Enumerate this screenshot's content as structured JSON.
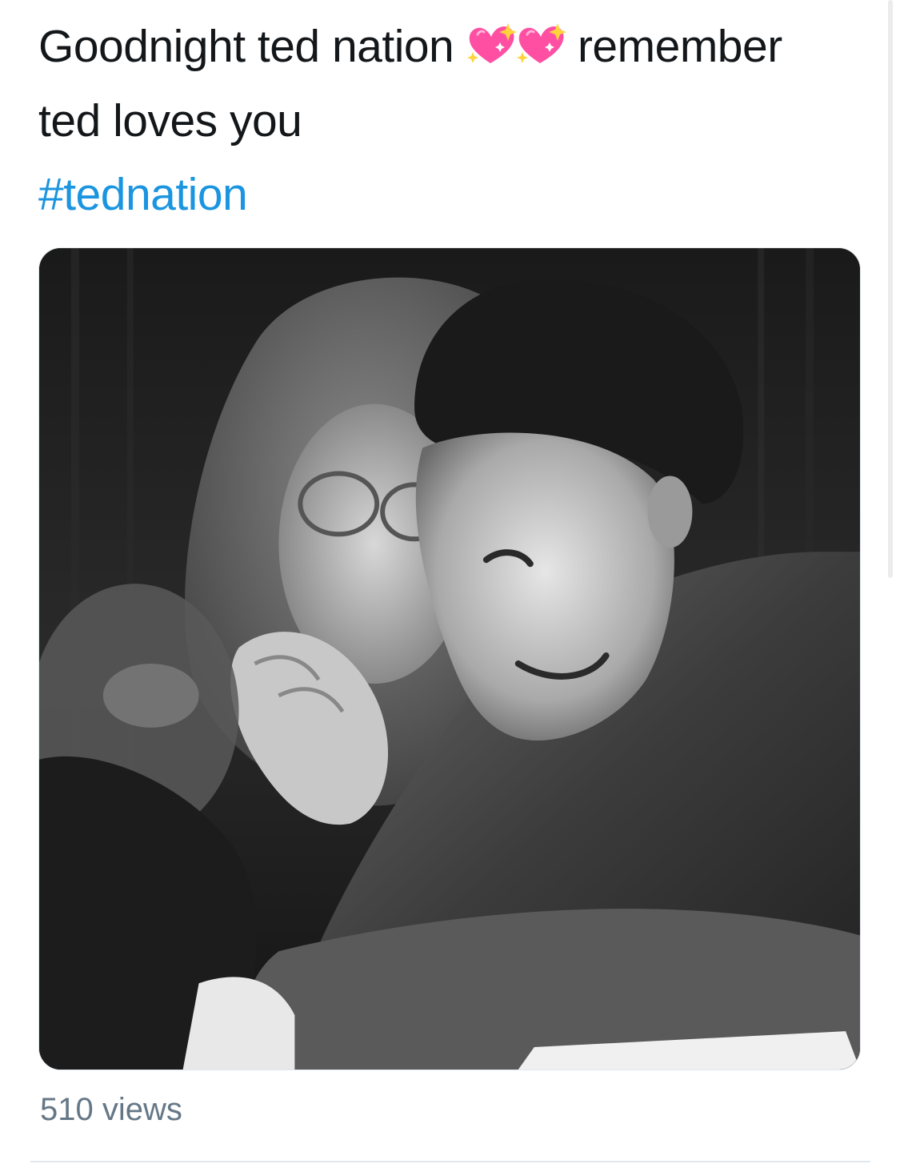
{
  "tweet": {
    "text_line1_a": "Goodnight ted nation",
    "text_line1_b": "remember",
    "text_line2": "ted loves you",
    "emojis": [
      "sparkling-heart",
      "sparkling-heart"
    ],
    "hashtag": "#tednation"
  },
  "media": {
    "type": "black-and-white photo",
    "icon": "photo"
  },
  "stats": {
    "views": "510 views"
  },
  "colors": {
    "text": "#14171a",
    "hashtag": "#1b95e0",
    "muted": "#657786",
    "heart": "#ff4fa3",
    "sparkle": "#ffd43b"
  }
}
